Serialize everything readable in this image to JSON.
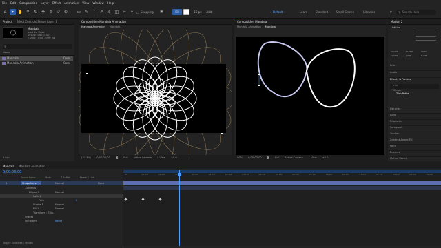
{
  "menubar": [
    "File",
    "Edit",
    "Composition",
    "Layer",
    "Effect",
    "Animation",
    "View",
    "Window",
    "Help"
  ],
  "toolbar": {
    "snapping": "Snapping",
    "workspaces": [
      "Default",
      "Learn",
      "Standard",
      "Small Screen",
      "Libraries"
    ],
    "search_help": "Search Help"
  },
  "project": {
    "tab_project": "Project",
    "tab_effect_controls": "Effect Controls Shape Layer 1",
    "item_name": "Mandala",
    "item_meta": [
      "used 1x, Undo",
      "1920 x 1080 (1.00)",
      "△ 0;00;15;00, 29.97 fps"
    ],
    "search_placeholder": "",
    "col_name": "Name",
    "items": [
      {
        "name": "Mandala",
        "type": "Com"
      },
      {
        "name": "Mandala Animation",
        "type": "Com"
      }
    ],
    "bpc": "8 bpc"
  },
  "comp_left": {
    "tab": "Composition Mandala Animation",
    "sub_tabs": [
      "Mandala Animation",
      "Mandala"
    ],
    "zoom": "(33.3%)",
    "timecode": "0;00;03;00",
    "quality": "Full",
    "camera": "Active Camera",
    "views": "1 View",
    "exposure": "+0.0"
  },
  "comp_right": {
    "tab": "Composition Mandala",
    "sub_tabs": [
      "Mandala Animation",
      "Mandala"
    ],
    "zoom": "50%",
    "timecode": "0;00;03;00",
    "quality": "Full",
    "camera": "Active Camera",
    "views": "1 View",
    "exposure": "+0.0"
  },
  "right_panel": {
    "tab": "Motion 2",
    "header": "Motion 2",
    "dropdown": "Untitled",
    "buttons": [
      "EXCITE",
      "BLEND",
      "SORT",
      "CLONE",
      "JUMP",
      "NAME"
    ],
    "sections": [
      "Info",
      "Audio",
      "Effects & Presets",
      "Libraries",
      "Align",
      "Character",
      "Paragraph",
      "Tracker",
      "Content-Aware Fill",
      "Paint",
      "Brushes",
      "Motion Sketch"
    ],
    "effects_search": "trim",
    "presets_group": "* Shape",
    "presets_item": "Trim Paths"
  },
  "timeline": {
    "tabs": [
      "Mandala",
      "Mandala Animation"
    ],
    "timecode": "0;00;03;00",
    "cols": [
      "Source Name",
      "Mode",
      "T TrkMat",
      "Parent & Link"
    ],
    "layer": {
      "num": "1",
      "name": "Shape Layer 1",
      "mode": "Normal",
      "parent": "None"
    },
    "rows": [
      {
        "label": "Contents",
        "value": "",
        "extra": ""
      },
      {
        "label": "Ellipse 1",
        "value": "Normal",
        "extra": ""
      },
      {
        "label": "Path 1",
        "value": "",
        "extra": ""
      },
      {
        "label": "Path",
        "value": "",
        "extra": ""
      },
      {
        "label": "Stroke 1",
        "value": "Normal",
        "extra": ""
      },
      {
        "label": "Fill 1",
        "value": "Normal",
        "extra": ""
      },
      {
        "label": "Transform : Ellip..",
        "value": "",
        "extra": ""
      },
      {
        "label": "Effects",
        "value": "",
        "extra": ""
      },
      {
        "label": "Transform",
        "value": "Reset",
        "extra": ""
      }
    ],
    "ruler": [
      "0f",
      "00:15f",
      "01:00f",
      "01:15f",
      "02:00f",
      "02:15f",
      "03:00f",
      "03:15f",
      "04:00f",
      "04:15f",
      "05:00f",
      "05:15f",
      "06:00f",
      "06:15f",
      "07:00f",
      "07:15f",
      "08:00f",
      "08:15f",
      "09:00f"
    ],
    "bottom": "Toggle Switches / Modes"
  },
  "colors": {
    "accent_blue": "#2a5ea8",
    "highlight_blue": "#4f9fff",
    "layer_blue": "#3c5d9c",
    "gold": "#b79a68"
  }
}
